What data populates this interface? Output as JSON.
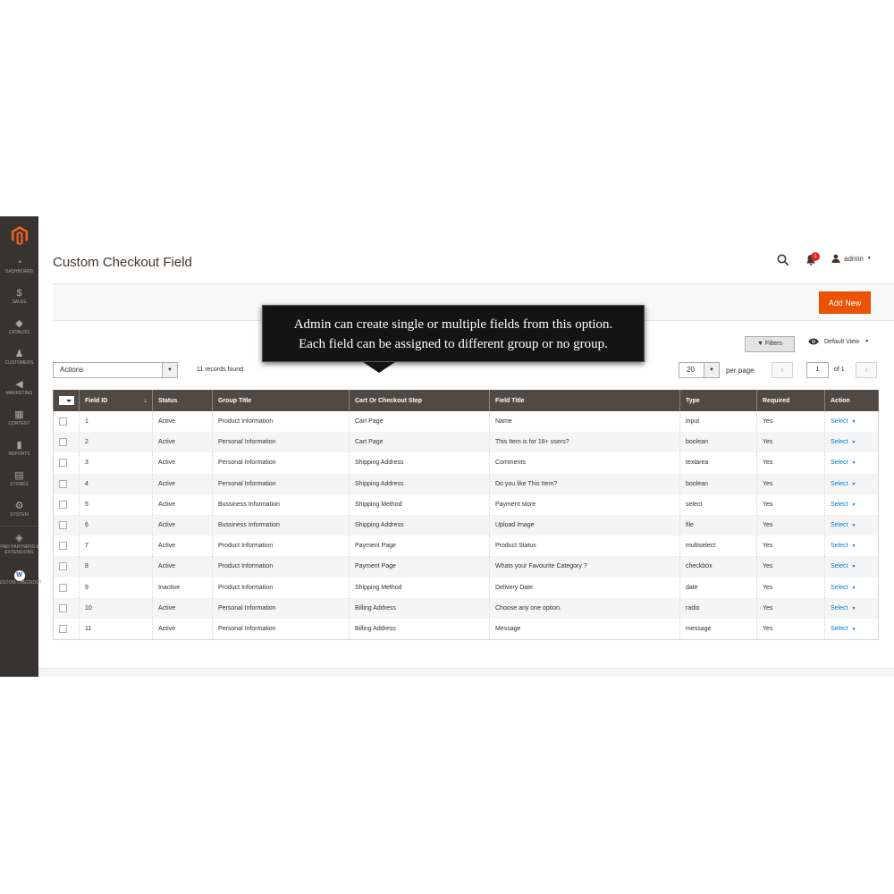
{
  "sidebar": {
    "items": [
      {
        "label": "DASHBOARD",
        "icon": "dashboard-icon"
      },
      {
        "label": "SALES",
        "icon": "dollar-icon"
      },
      {
        "label": "CATALOG",
        "icon": "box-icon"
      },
      {
        "label": "CUSTOMERS",
        "icon": "person-icon"
      },
      {
        "label": "MARKETING",
        "icon": "megaphone-icon"
      },
      {
        "label": "CONTENT",
        "icon": "content-icon"
      },
      {
        "label": "REPORTS",
        "icon": "bar-chart-icon"
      },
      {
        "label": "STORES",
        "icon": "store-icon"
      },
      {
        "label": "SYSTEM",
        "icon": "gear-icon"
      },
      {
        "label": "FIND PARTNERS & EXTENSIONS",
        "icon": "extensions-icon"
      },
      {
        "label": "CUSTOM CHECKOUT",
        "icon": "custom-checkout-icon"
      }
    ]
  },
  "header": {
    "title": "Custom Checkout Field",
    "notification_count": "1",
    "user": "admin"
  },
  "toolbar": {
    "add_new_label": "Add New",
    "filters_label": "Filters",
    "view_label": "Default View"
  },
  "grid_controls": {
    "actions_label": "Actions",
    "records_found": "11 records found",
    "per_page_value": "20",
    "per_page_label": "per page",
    "current_page": "1",
    "page_of": "of 1"
  },
  "tooltip": {
    "line1": "Admin can create single or multiple fields from this option.",
    "line2": "Each field can be assigned to different group or no group."
  },
  "columns": [
    "Field ID",
    "Status",
    "Group Title",
    "Cart Or Checkout Step",
    "Field Title",
    "Type",
    "Required",
    "Action"
  ],
  "rows": [
    {
      "id": "1",
      "status": "Active",
      "group": "Product Information",
      "step": "Cart Page",
      "title": "Name",
      "type": "input",
      "required": "Yes",
      "action": "Select"
    },
    {
      "id": "2",
      "status": "Active",
      "group": "Personal Information",
      "step": "Cart Page",
      "title": "This Item is for 18+ users?",
      "type": "boolean",
      "required": "Yes",
      "action": "Select"
    },
    {
      "id": "3",
      "status": "Active",
      "group": "Personal Information",
      "step": "Shipping Address",
      "title": "Comments",
      "type": "textarea",
      "required": "Yes",
      "action": "Select"
    },
    {
      "id": "4",
      "status": "Active",
      "group": "Personal Information",
      "step": "Shipping Address",
      "title": "Do you like This Item?",
      "type": "boolean",
      "required": "Yes",
      "action": "Select"
    },
    {
      "id": "5",
      "status": "Active",
      "group": "Bussiness Information",
      "step": "Shipping Method",
      "title": "Payment store",
      "type": "select",
      "required": "Yes",
      "action": "Select"
    },
    {
      "id": "6",
      "status": "Active",
      "group": "Bussiness Information",
      "step": "Shipping Address",
      "title": "Upload Image",
      "type": "file",
      "required": "Yes",
      "action": "Select"
    },
    {
      "id": "7",
      "status": "Active",
      "group": "Product Information",
      "step": "Payment Page",
      "title": "Product Status",
      "type": "multiselect",
      "required": "Yes",
      "action": "Select"
    },
    {
      "id": "8",
      "status": "Active",
      "group": "Product Information",
      "step": "Payment Page",
      "title": "Whats your Favourite Category ?",
      "type": "checkbox",
      "required": "Yes",
      "action": "Select"
    },
    {
      "id": "9",
      "status": "Inactive",
      "group": "Product Information",
      "step": "Shipping Method",
      "title": "Delivery Date",
      "type": "date",
      "required": "Yes",
      "action": "Select"
    },
    {
      "id": "10",
      "status": "Active",
      "group": "Personal Information",
      "step": "Billing Address",
      "title": "Choose any one option.",
      "type": "radio",
      "required": "Yes",
      "action": "Select"
    },
    {
      "id": "11",
      "status": "Active",
      "group": "Personal Information",
      "step": "Billing Address",
      "title": "Message",
      "type": "message",
      "required": "Yes",
      "action": "Select"
    }
  ],
  "colors": {
    "sidebar_bg": "#373330",
    "accent": "#eb5202",
    "grid_header": "#514943",
    "link": "#007bdb"
  }
}
